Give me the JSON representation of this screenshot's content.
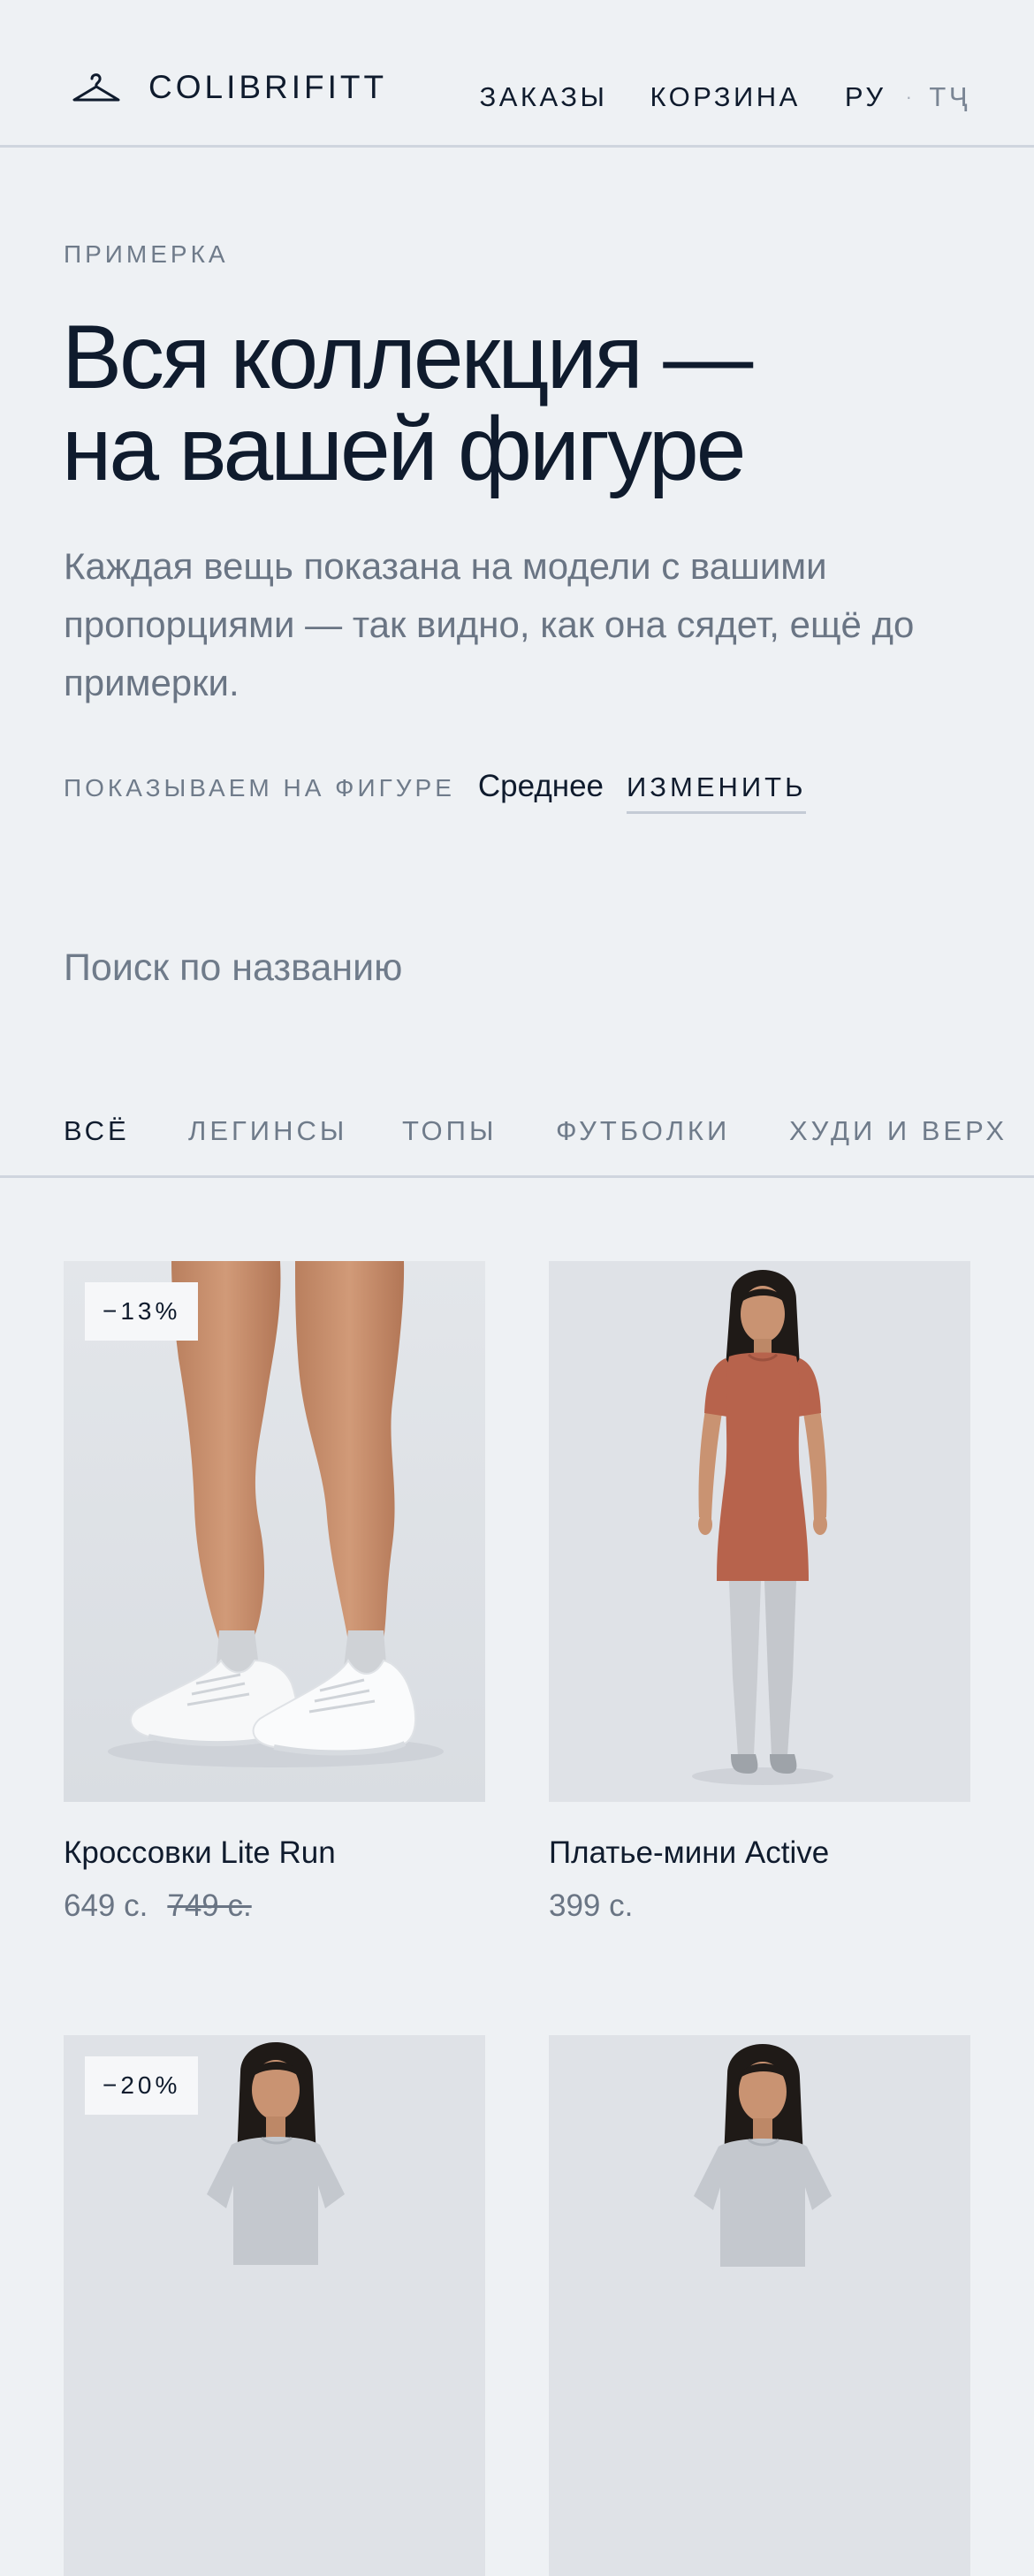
{
  "header": {
    "brand": "COLIBRIFITT",
    "nav": {
      "orders": "ЗАКАЗЫ",
      "cart": "КОРЗИНА",
      "lang_current": "РУ",
      "separator": "·",
      "lang_alt": "ТҶ"
    }
  },
  "hero": {
    "eyebrow": "ПРИМЕРКА",
    "title_line1": "Вся коллекция —",
    "title_line2": "на вашей фигуре",
    "subtitle": "Каждая вещь показана на модели с вашими пропорциями — так видно, как она сядет, ещё до примерки.",
    "figure_label": "ПОКАЗЫВАЕМ НА ФИГУРЕ",
    "figure_value": "Среднее",
    "figure_change": "ИЗМЕНИТЬ"
  },
  "search": {
    "placeholder": "Поиск по названию",
    "value": ""
  },
  "tabs": [
    {
      "label": "ВСЁ",
      "active": true
    },
    {
      "label": "ЛЕГИНСЫ",
      "active": false
    },
    {
      "label": "ТОПЫ",
      "active": false
    },
    {
      "label": "ФУТБОЛКИ",
      "active": false
    },
    {
      "label": "ХУДИ И ВЕРХ",
      "active": false
    }
  ],
  "products": [
    {
      "name": "Кроссовки Lite Run",
      "price": "649 с.",
      "old_price": "749 с.",
      "badge": "−13%",
      "image": "white-sneakers-on-legs"
    },
    {
      "name": "Платье-мини Active",
      "price": "399 с.",
      "old_price": "",
      "badge": "",
      "image": "model-terracotta-mini-dress-grey-leggings"
    },
    {
      "name": "",
      "price": "",
      "old_price": "",
      "badge": "−20%",
      "image": "model-grey-tshirt"
    },
    {
      "name": "",
      "price": "",
      "old_price": "",
      "badge": "",
      "image": "model-grey-tshirt"
    }
  ],
  "colors": {
    "background": "#eef1f4",
    "text_primary": "#0f1b2d",
    "text_muted": "#6f7b8a",
    "divider": "#cfd5de",
    "card_image_bg": "#dfe3e8",
    "dress": "#b7634c",
    "leggings": "#c9ccd1",
    "tshirt": "#c4c8ce",
    "skin": "#c9916f"
  }
}
